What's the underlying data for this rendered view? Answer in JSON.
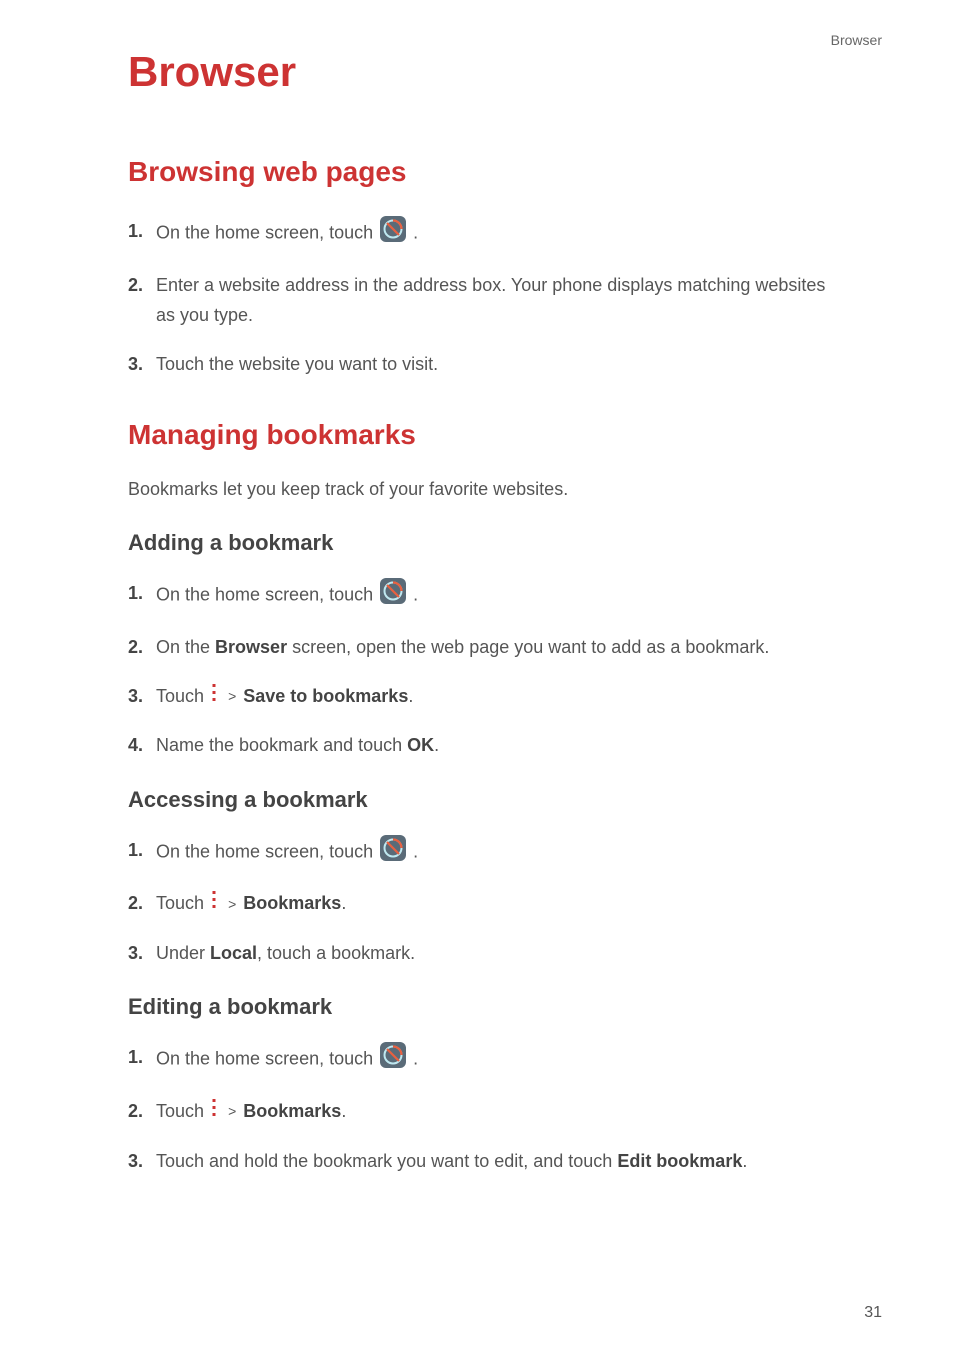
{
  "header_label": "Browser",
  "page_title": "Browser",
  "page_number": "31",
  "colors": {
    "accent": "#cd3333"
  },
  "section1": {
    "title": "Browsing web pages",
    "steps": {
      "s1_pre": "On the home screen, touch ",
      "s1_post": ".",
      "s2": "Enter a website address in the address box. Your phone displays matching websites as you type.",
      "s3": "Touch the website you want to visit."
    }
  },
  "section2": {
    "title": "Managing bookmarks",
    "intro": "Bookmarks let you keep track of your favorite websites.",
    "sub_add": {
      "title": "Adding  a  bookmark",
      "s1_pre": "On the home screen, touch ",
      "s1_post": ".",
      "s2_pre": "On the ",
      "s2_bold": "Browser",
      "s2_post": " screen, open the web page you want to add as a bookmark.",
      "s3_pre": "Touch ",
      "s3_gt": ">",
      "s3_bold": "Save to bookmarks",
      "s3_post": ".",
      "s4_pre": "Name the bookmark and touch ",
      "s4_bold": "OK",
      "s4_post": "."
    },
    "sub_access": {
      "title": "Accessing  a  bookmark",
      "s1_pre": "On the home screen, touch ",
      "s1_post": ".",
      "s2_pre": "Touch ",
      "s2_gt": ">",
      "s2_bold": "Bookmarks",
      "s2_post": ".",
      "s3_pre": "Under ",
      "s3_bold": "Local",
      "s3_post": ", touch a bookmark."
    },
    "sub_edit": {
      "title": "Editing  a  bookmark",
      "s1_pre": "On the home screen, touch ",
      "s1_post": ".",
      "s2_pre": "Touch ",
      "s2_gt": ">",
      "s2_bold": "Bookmarks",
      "s2_post": ".",
      "s3_pre": "Touch and hold the bookmark you want to edit, and touch ",
      "s3_bold": "Edit bookmark",
      "s3_post": "."
    }
  }
}
